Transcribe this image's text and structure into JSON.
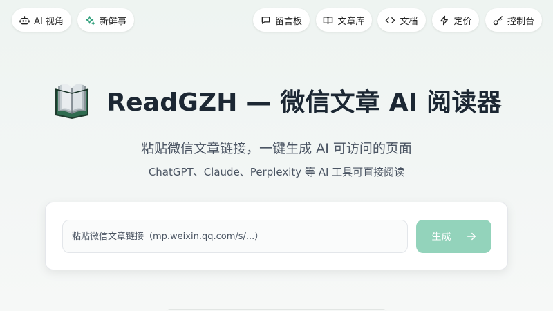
{
  "nav_left": [
    {
      "label": "AI 视角",
      "icon": "robot-icon"
    },
    {
      "label": "新鲜事",
      "icon": "sparkle-icon"
    }
  ],
  "nav_right": [
    {
      "label": "留言板",
      "icon": "message-icon"
    },
    {
      "label": "文章库",
      "icon": "book-open-icon"
    },
    {
      "label": "文档",
      "icon": "code-icon"
    },
    {
      "label": "定价",
      "icon": "lightning-icon"
    },
    {
      "label": "控制台",
      "icon": "key-icon"
    }
  ],
  "hero": {
    "icon": "book-icon",
    "title": "ReadGZH — 微信文章 AI 阅读器",
    "subtitle": "粘贴微信文章链接，一键生成 AI 可访问的页面",
    "subtitle2": "ChatGPT、Claude、Perplexity 等 AI 工具可直接阅读"
  },
  "form": {
    "placeholder": "粘贴微信文章链接（mp.weixin.qq.com/s/...）",
    "value": "",
    "button_label": "生成",
    "button_color": "#93d3bb"
  }
}
